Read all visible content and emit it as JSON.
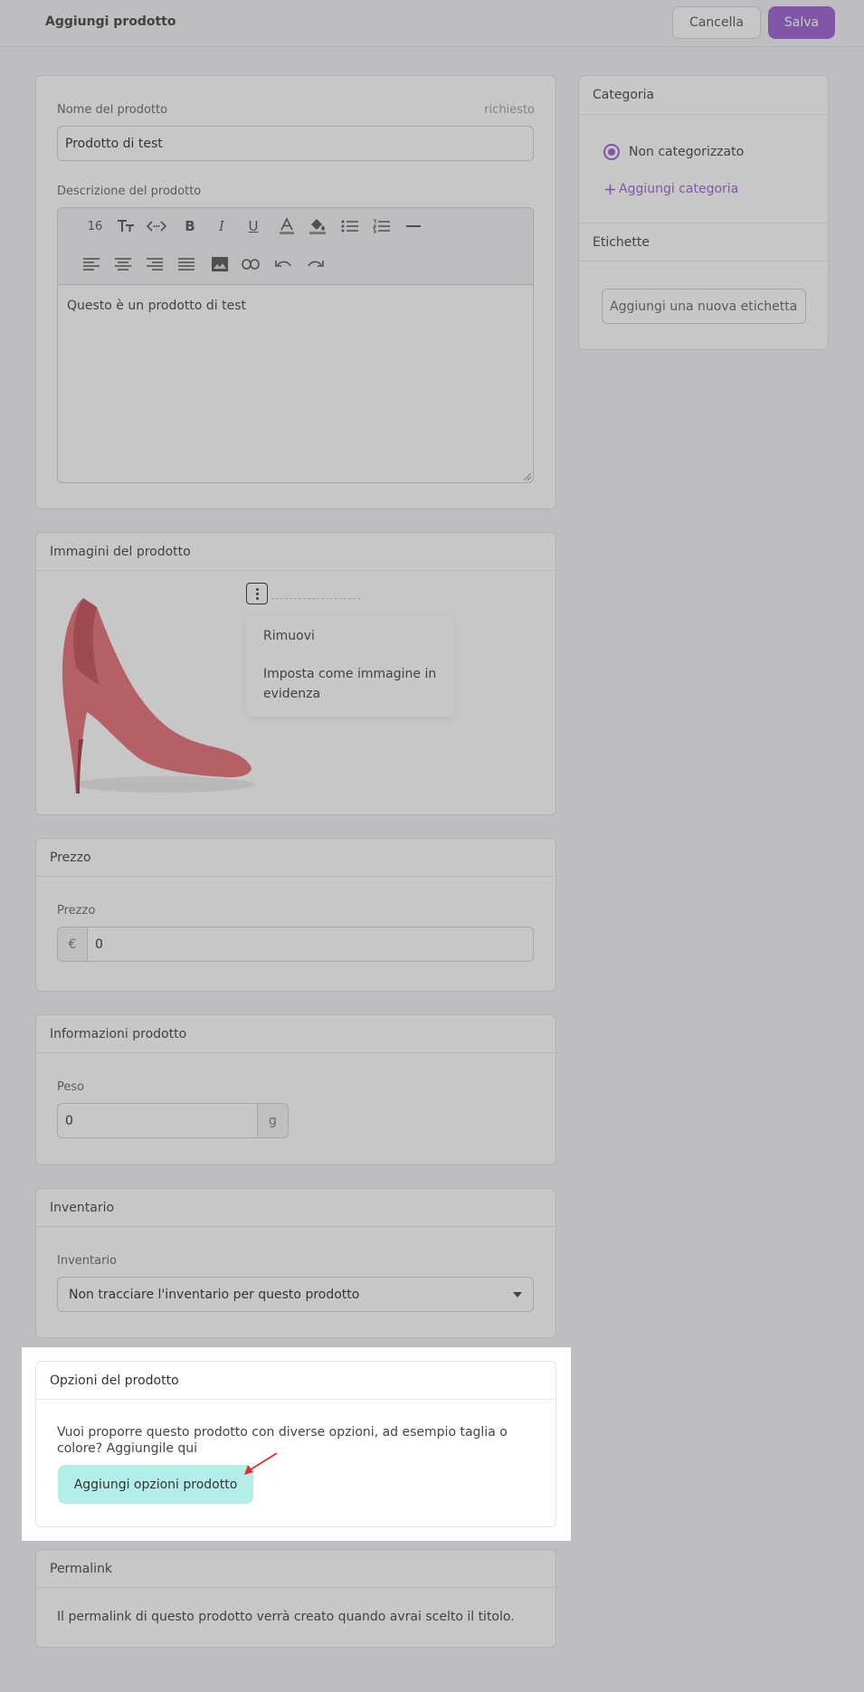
{
  "header": {
    "title": "Aggiungi prodotto",
    "cancel_label": "Cancella",
    "save_label": "Salva"
  },
  "details": {
    "name_label": "Nome del prodotto",
    "required_label": "richiesto",
    "name_value": "Prodotto di test",
    "description_label": "Descrizione del prodotto",
    "description_value": "Questo è un prodotto di test",
    "font_size": "16"
  },
  "images": {
    "title": "Immagini del prodotto",
    "menu_remove": "Rimuovi",
    "menu_featured": "Imposta come immagine in evidenza"
  },
  "price": {
    "title": "Prezzo",
    "label": "Prezzo",
    "currency": "€",
    "value": "0"
  },
  "info": {
    "title": "Informazioni prodotto",
    "weight_label": "Peso",
    "weight_value": "0",
    "unit": "g"
  },
  "inventory": {
    "title": "Inventario",
    "label": "Inventario",
    "selected": "Non tracciare l'inventario per questo prodotto"
  },
  "options": {
    "title": "Opzioni del prodotto",
    "description": "Vuoi proporre questo prodotto con diverse opzioni, ad esempio taglia o colore? Aggiungile qui",
    "button_label": "Aggiungi opzioni prodotto"
  },
  "permalink": {
    "title": "Permalink",
    "text": "Il permalink di questo prodotto verrà creato quando avrai scelto il titolo."
  },
  "category": {
    "title": "Categoria",
    "selected": "Non categorizzato",
    "add_label": "Aggiungi categoria"
  },
  "tags": {
    "title": "Etichette",
    "placeholder": "Aggiungi una nuova etichetta"
  },
  "colors": {
    "accent": "#a66fd9",
    "options_button": "#b3efe8"
  }
}
